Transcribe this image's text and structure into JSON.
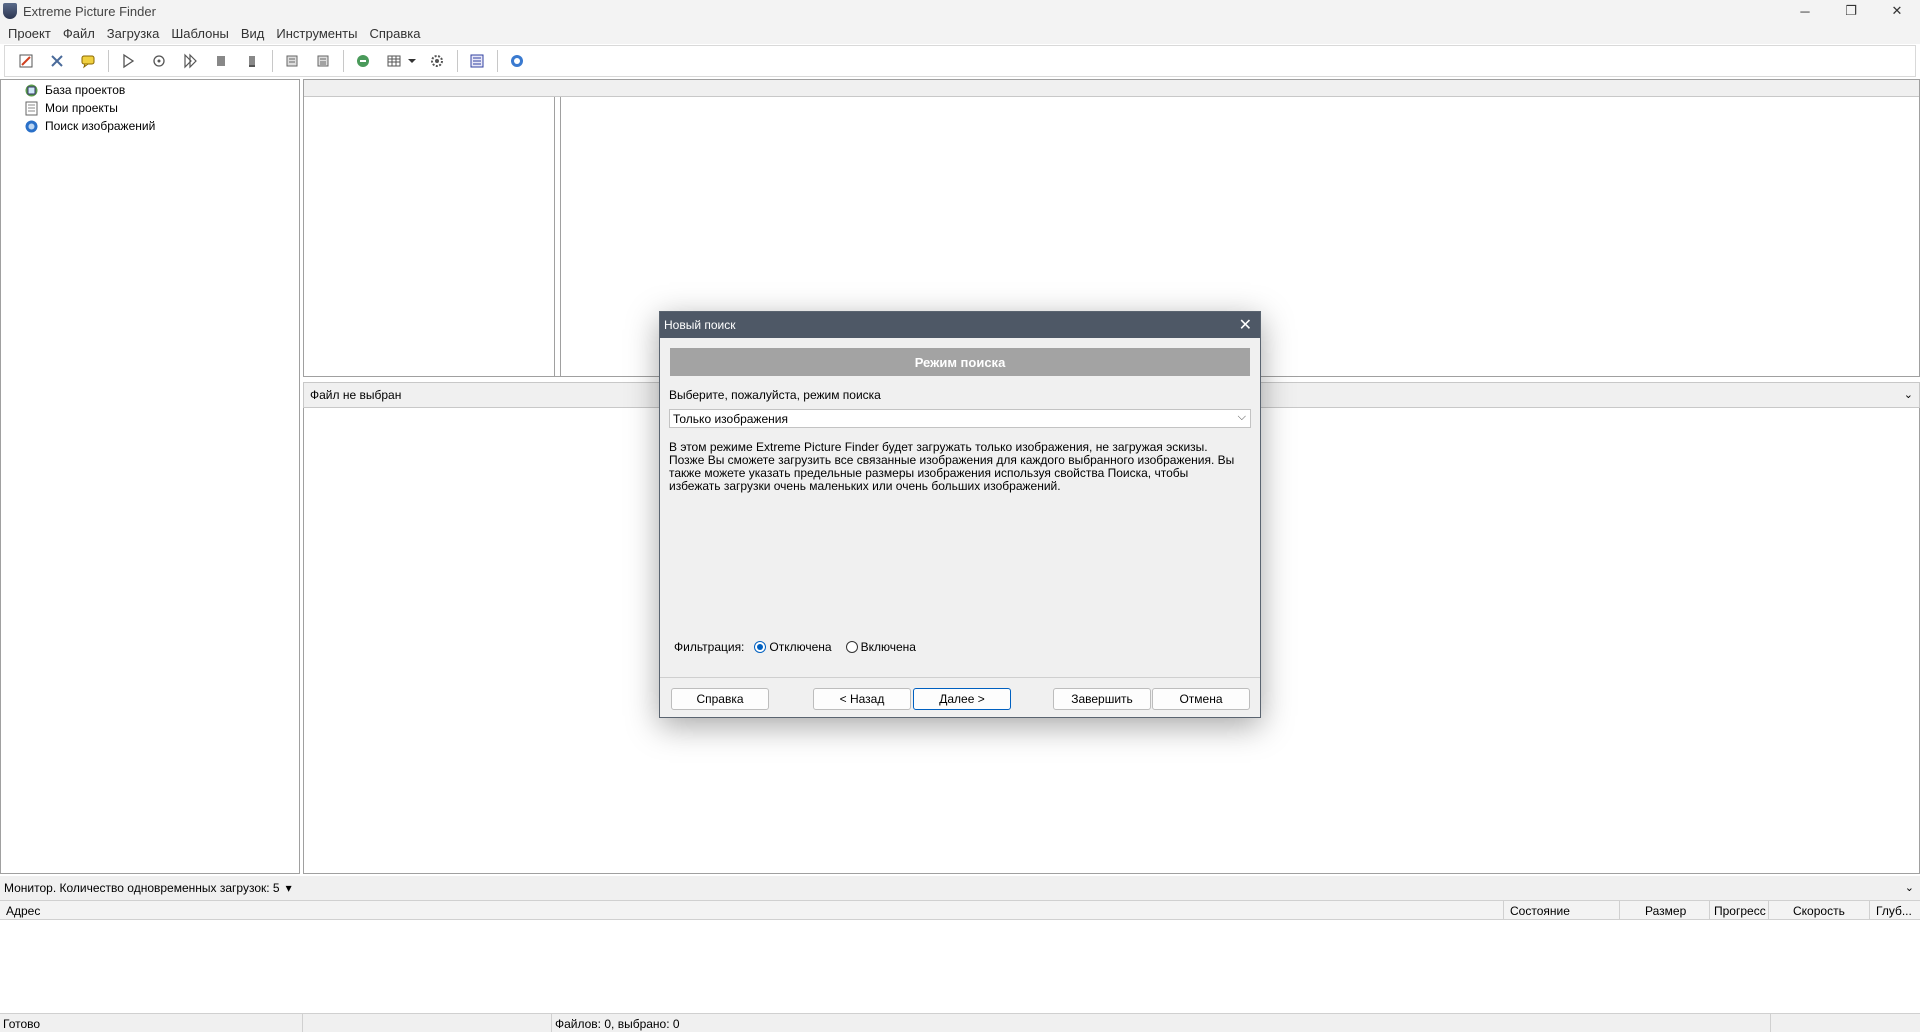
{
  "window": {
    "title": "Extreme Picture Finder",
    "minimize": "─",
    "maximize": "❐",
    "close": "✕"
  },
  "menu": [
    "Проект",
    "Файл",
    "Загрузка",
    "Шаблоны",
    "Вид",
    "Инструменты",
    "Справка"
  ],
  "tree": [
    {
      "label": "База проектов",
      "icon": "database-icon"
    },
    {
      "label": "Мои проекты",
      "icon": "projects-icon"
    },
    {
      "label": "Поиск изображений",
      "icon": "globe-search-icon"
    }
  ],
  "filebar": {
    "label": "Файл не выбран",
    "chevron": "⌄"
  },
  "monitor": {
    "label": "Монитор. Количество одновременных загрузок: 5",
    "dropdown": "▾",
    "chevron": "⌄"
  },
  "downloads": {
    "columns": [
      "Адрес",
      "Состояние",
      "Размер",
      "Прогресс",
      "Скорость",
      "Глуб..."
    ]
  },
  "status": {
    "ready": "Готово",
    "files": "Файлов: 0, выбрано: 0"
  },
  "dialog": {
    "title": "Новый поиск",
    "close": "✕",
    "banner": "Режим поиска",
    "prompt": "Выберите, пожалуйста, режим поиска",
    "mode_selected": "Только изображения",
    "select_arrow": "⌵",
    "description": "В этом режиме Extreme Picture Finder будет загружать только изображения, не загружая эскизы. Позже Вы сможете загрузить все связанные изображения для каждого выбранного изображения. Вы также можете указать предельные размеры изображения используя свойства Поиска, чтобы избежать загрузки очень маленьких или очень больших изображений.",
    "filter_label": "Фильтрация:",
    "filter_off": "Отключена",
    "filter_on": "Включена",
    "buttons": {
      "help": "Справка",
      "back": "< Назад",
      "next": "Далее >",
      "finish": "Завершить",
      "cancel": "Отмена"
    }
  }
}
